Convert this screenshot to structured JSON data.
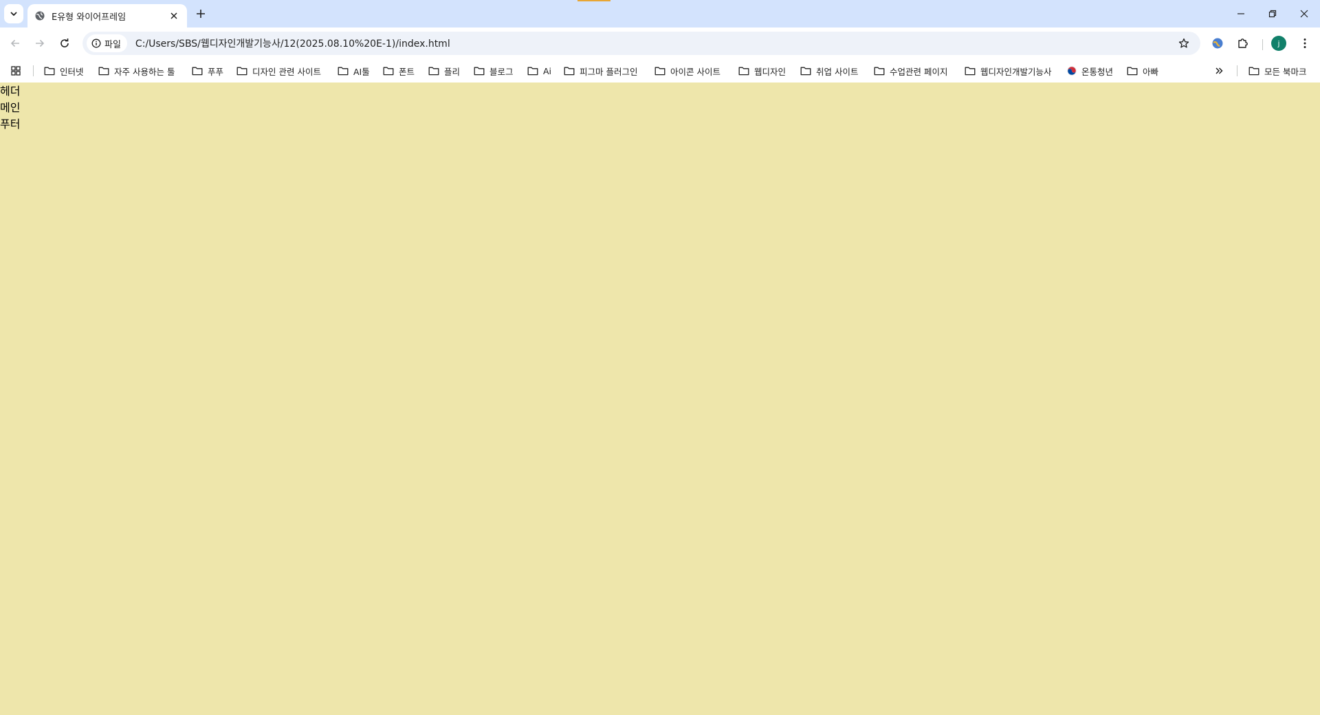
{
  "browser": {
    "tab_title": "E유형 와이어프레임",
    "site_chip_label": "파일",
    "url": "C:/Users/SBS/웹디자인개발기능사/12(2025.08.10%20E-1)/index.html",
    "profile_initial": "j",
    "profile_color": "#11806A",
    "accent_color": "#D3E3FD"
  },
  "bookmarks": [
    {
      "label": "인터넷",
      "icon": "folder-icon"
    },
    {
      "label": "자주 사용하는 툴",
      "icon": "folder-icon"
    },
    {
      "label": "푸푸",
      "icon": "folder-icon"
    },
    {
      "label": "디자인 관련 사이트",
      "icon": "folder-icon"
    },
    {
      "label": "AI툴",
      "icon": "folder-icon"
    },
    {
      "label": "폰트",
      "icon": "folder-icon"
    },
    {
      "label": "플리",
      "icon": "folder-icon"
    },
    {
      "label": "블로그",
      "icon": "folder-icon"
    },
    {
      "label": "Ai",
      "icon": "folder-icon"
    },
    {
      "label": "피그마 플러그인",
      "icon": "folder-icon"
    },
    {
      "label": "아이콘 사이트",
      "icon": "folder-icon"
    },
    {
      "label": "웹디자인",
      "icon": "folder-icon"
    },
    {
      "label": "취업 사이트",
      "icon": "folder-icon"
    },
    {
      "label": "수업관련 페이지",
      "icon": "folder-icon"
    },
    {
      "label": "웹디자인개발기능사",
      "icon": "folder-icon"
    },
    {
      "label": "온통청년",
      "icon": "taegeuk-icon"
    },
    {
      "label": "아빠",
      "icon": "folder-icon"
    }
  ],
  "all_bookmarks_label": "모든 북마크",
  "page": {
    "background": "#EEE6AB",
    "lines": [
      "헤더",
      "메인",
      "푸터"
    ]
  }
}
